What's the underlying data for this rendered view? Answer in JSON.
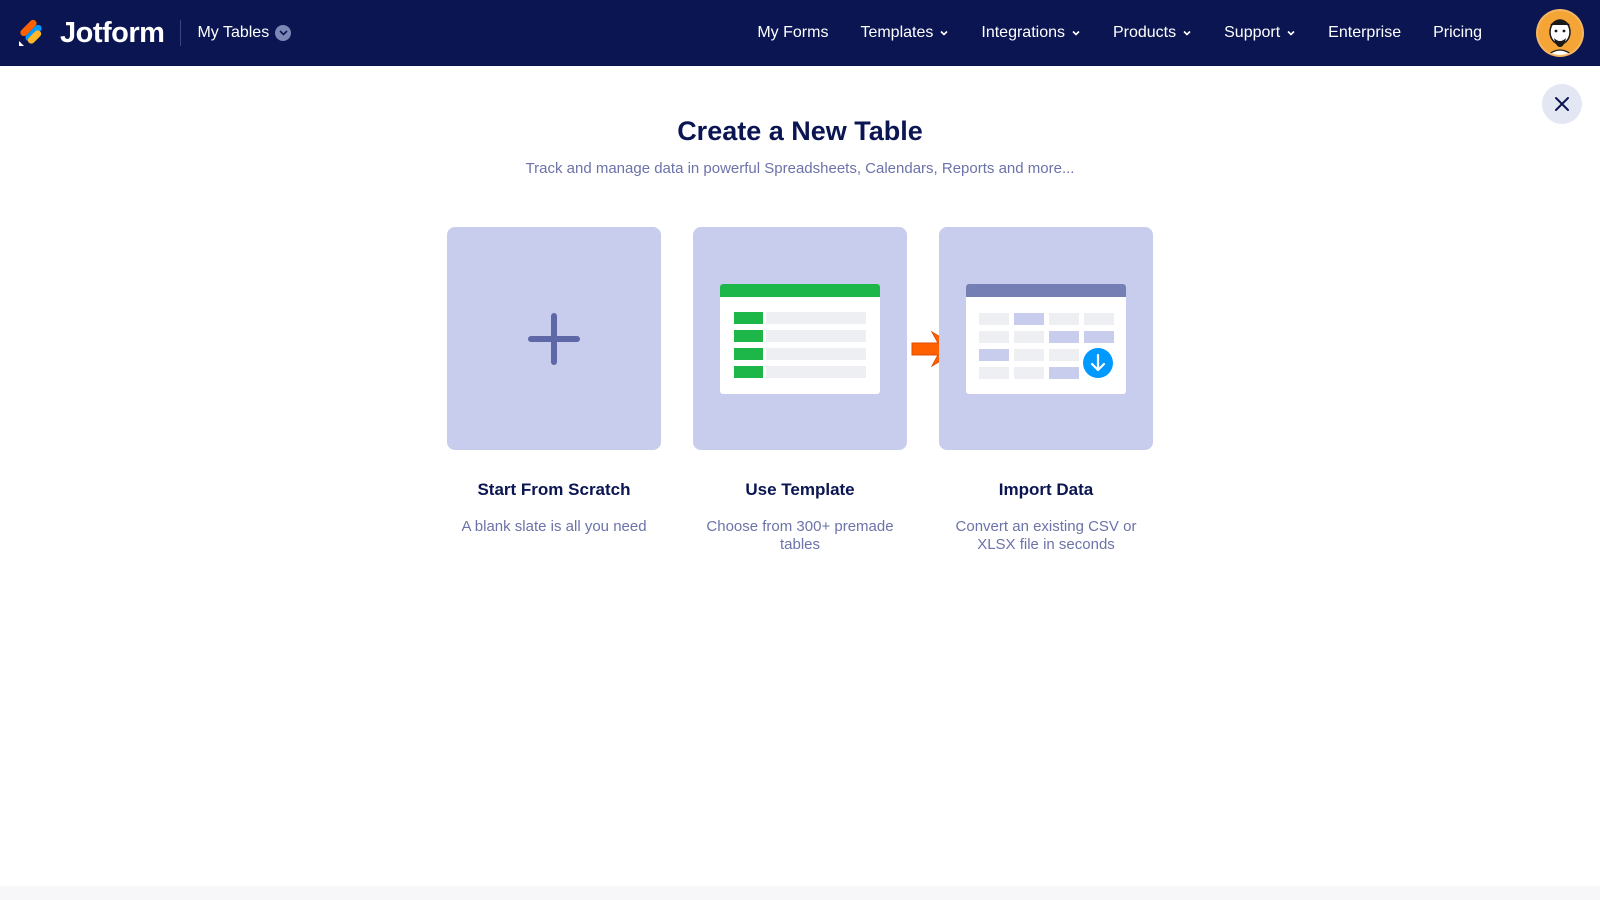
{
  "header": {
    "brand": "Jotform",
    "section": "My Tables",
    "nav": [
      {
        "label": "My Forms",
        "has_caret": false
      },
      {
        "label": "Templates",
        "has_caret": true
      },
      {
        "label": "Integrations",
        "has_caret": true
      },
      {
        "label": "Products",
        "has_caret": true
      },
      {
        "label": "Support",
        "has_caret": true
      },
      {
        "label": "Enterprise",
        "has_caret": false
      },
      {
        "label": "Pricing",
        "has_caret": false
      }
    ]
  },
  "main": {
    "title": "Create a New Table",
    "subtitle": "Track and manage data in powerful Spreadsheets, Calendars, Reports and more...",
    "options": [
      {
        "title": "Start From Scratch",
        "description": "A blank slate is all you need",
        "icon": "plus-icon"
      },
      {
        "title": "Use Template",
        "description": "Choose from 300+ premade tables",
        "icon": "template-table-icon"
      },
      {
        "title": "Import Data",
        "description": "Convert an existing CSV or XLSX file in seconds",
        "icon": "import-table-icon"
      }
    ]
  },
  "colors": {
    "header_bg": "#0a1551",
    "tile_bg": "#c8cdee",
    "green": "#1db648",
    "import_blue": "#0099ff",
    "arrow_orange": "#ff6100"
  }
}
